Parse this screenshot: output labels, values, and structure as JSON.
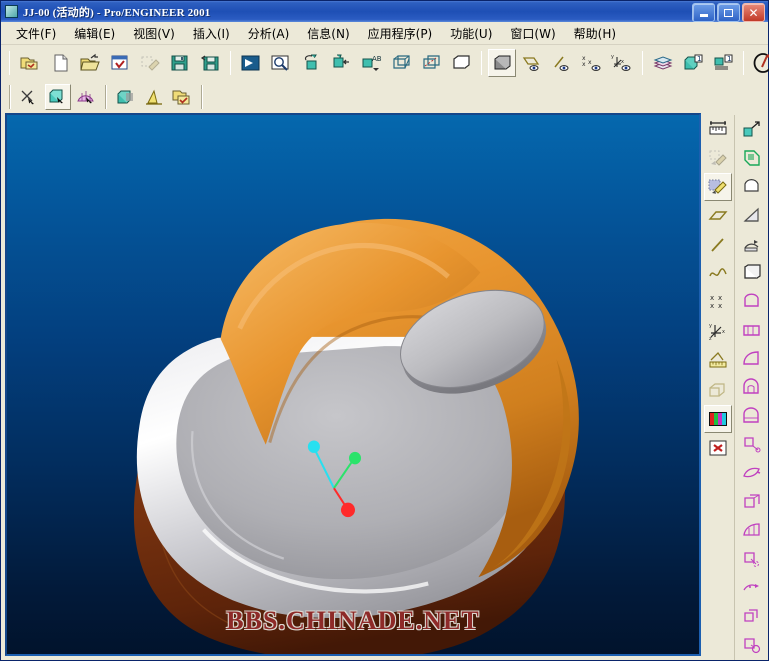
{
  "window": {
    "title": "JJ-00 (活动的) - Pro/ENGINEER 2001",
    "icon": "document-icon",
    "controls": {
      "minimize": "minimize-button",
      "maximize": "maximize-button",
      "close": "close-button"
    }
  },
  "menubar": {
    "items": [
      {
        "label": "文件(F)",
        "name": "menu-file"
      },
      {
        "label": "编辑(E)",
        "name": "menu-edit"
      },
      {
        "label": "视图(V)",
        "name": "menu-view"
      },
      {
        "label": "插入(I)",
        "name": "menu-insert"
      },
      {
        "label": "分析(A)",
        "name": "menu-analysis"
      },
      {
        "label": "信息(N)",
        "name": "menu-info"
      },
      {
        "label": "应用程序(P)",
        "name": "menu-applications"
      },
      {
        "label": "功能(U)",
        "name": "menu-utilities"
      },
      {
        "label": "窗口(W)",
        "name": "menu-window"
      },
      {
        "label": "帮助(H)",
        "name": "menu-help"
      }
    ]
  },
  "toolbar_top": {
    "groups": [
      {
        "name": "file-group",
        "buttons": [
          {
            "icon": "open-workdir-icon",
            "state": "normal"
          },
          {
            "icon": "new-file-icon",
            "state": "normal"
          },
          {
            "icon": "open-file-icon",
            "state": "normal"
          },
          {
            "icon": "window-select-icon",
            "state": "normal"
          },
          {
            "icon": "erase-icon",
            "state": "disabled"
          },
          {
            "icon": "save-icon",
            "state": "normal"
          },
          {
            "icon": "save-copy-icon",
            "state": "normal"
          }
        ]
      },
      {
        "name": "view-group",
        "buttons": [
          {
            "icon": "repaint-icon",
            "state": "normal"
          },
          {
            "icon": "zoom-in-icon",
            "state": "normal"
          },
          {
            "icon": "reorient-icon",
            "state": "normal"
          },
          {
            "icon": "saved-view-icon",
            "state": "normal"
          },
          {
            "icon": "named-view-ab-icon",
            "state": "normal"
          },
          {
            "icon": "datum-plane-icon",
            "state": "normal"
          },
          {
            "icon": "datum-axis-icon",
            "state": "normal"
          },
          {
            "icon": "no-hidden-icon",
            "state": "normal"
          }
        ]
      },
      {
        "name": "display-group",
        "buttons": [
          {
            "icon": "shading-icon",
            "state": "pressed"
          },
          {
            "icon": "plane-display-icon",
            "state": "normal"
          },
          {
            "icon": "axis-display-icon",
            "state": "normal"
          },
          {
            "icon": "point-display-icon",
            "state": "normal"
          },
          {
            "icon": "csys-display-icon",
            "state": "normal"
          }
        ]
      },
      {
        "name": "model-group",
        "buttons": [
          {
            "icon": "layers-icon",
            "state": "normal"
          },
          {
            "icon": "simplified-rep-icon",
            "state": "normal"
          },
          {
            "icon": "model-tree-icon",
            "state": "normal"
          }
        ]
      },
      {
        "name": "annotate-group",
        "buttons": [
          {
            "icon": "annotate-pen-icon",
            "state": "normal"
          }
        ]
      }
    ]
  },
  "toolbar_second": {
    "groups": [
      {
        "name": "select-group",
        "buttons": [
          {
            "icon": "select-items-icon",
            "state": "normal"
          },
          {
            "icon": "select-geometry-icon",
            "state": "pressed"
          },
          {
            "icon": "select-surface-icon",
            "state": "normal"
          }
        ]
      },
      {
        "name": "feature-group",
        "buttons": [
          {
            "icon": "shaded-solid-icon",
            "state": "normal"
          },
          {
            "icon": "draft-feature-icon",
            "state": "normal"
          },
          {
            "icon": "folder-check-icon",
            "state": "normal"
          }
        ]
      }
    ]
  },
  "toolbar_right_inner": {
    "name": "analysis-toolbar",
    "buttons": [
      {
        "icon": "measure-ruler-icon",
        "state": "normal"
      },
      {
        "icon": "eraser-icon",
        "state": "disabled"
      },
      {
        "icon": "highlight-pen-icon",
        "state": "pressed"
      },
      {
        "icon": "datum-plane-create-icon",
        "state": "normal"
      },
      {
        "icon": "datum-line-icon",
        "state": "normal"
      },
      {
        "icon": "datum-curve-icon",
        "state": "normal"
      },
      {
        "icon": "datum-point-icon",
        "state": "normal"
      },
      {
        "icon": "datum-csys-icon",
        "state": "normal"
      },
      {
        "icon": "measure-analysis-icon",
        "state": "normal"
      },
      {
        "icon": "section-icon",
        "state": "disabled"
      },
      {
        "icon": "color-appearance-icon",
        "state": "pressed"
      },
      {
        "icon": "delete-red-x-icon",
        "state": "normal"
      }
    ]
  },
  "toolbar_right_outer": {
    "name": "feature-creation-toolbar",
    "buttons": [
      {
        "icon": "extrude-icon",
        "state": "normal"
      },
      {
        "icon": "sketch-icon",
        "state": "normal"
      },
      {
        "icon": "revolve-icon",
        "state": "normal"
      },
      {
        "icon": "sweep-icon",
        "state": "normal"
      },
      {
        "icon": "blend-icon",
        "state": "normal"
      },
      {
        "icon": "protrusion-icon",
        "state": "normal"
      },
      {
        "icon": "cut-feature-icon",
        "state": "normal"
      },
      {
        "icon": "hole-icon",
        "state": "normal"
      },
      {
        "icon": "shell-icon",
        "state": "normal"
      },
      {
        "icon": "round-icon",
        "state": "normal"
      },
      {
        "icon": "chamfer-icon",
        "state": "normal"
      },
      {
        "icon": "surface-extrude-icon",
        "state": "normal"
      },
      {
        "icon": "surface-flat-icon",
        "state": "normal"
      },
      {
        "icon": "surface-revolve-icon",
        "state": "normal"
      },
      {
        "icon": "surface-blend-icon",
        "state": "normal"
      },
      {
        "icon": "surface-trim-icon",
        "state": "normal"
      },
      {
        "icon": "surface-offset-icon",
        "state": "normal"
      },
      {
        "icon": "surface-merge-icon",
        "state": "normal"
      },
      {
        "icon": "surface-thicken-icon",
        "state": "normal"
      }
    ]
  },
  "viewport": {
    "name": "graphics-window",
    "watermark": "BBS.CHINADE.NET",
    "background": {
      "top_color": "#0568AE",
      "bottom_color": "#01132C"
    },
    "model": {
      "name": "shaded-3d-part",
      "description": "Shaded solid model of a molded foot-bath / basin shell",
      "colors": {
        "orange_shell": "#E59230",
        "orange_shadow": "#B96A18",
        "silver_rim": "#D9D9DC",
        "silver_highlight": "#FFFFFF",
        "silver_interior": "#ACACB0",
        "brown_base": "#7A3310",
        "brown_dark": "#55210A",
        "grey_pad": "#BDBDC0"
      },
      "csys_marker": {
        "name": "coordinate-system-marker",
        "axis_x_color": "#FF2A2A",
        "axis_y_color": "#2BE36B",
        "axis_z_color": "#27E0F0"
      }
    }
  }
}
